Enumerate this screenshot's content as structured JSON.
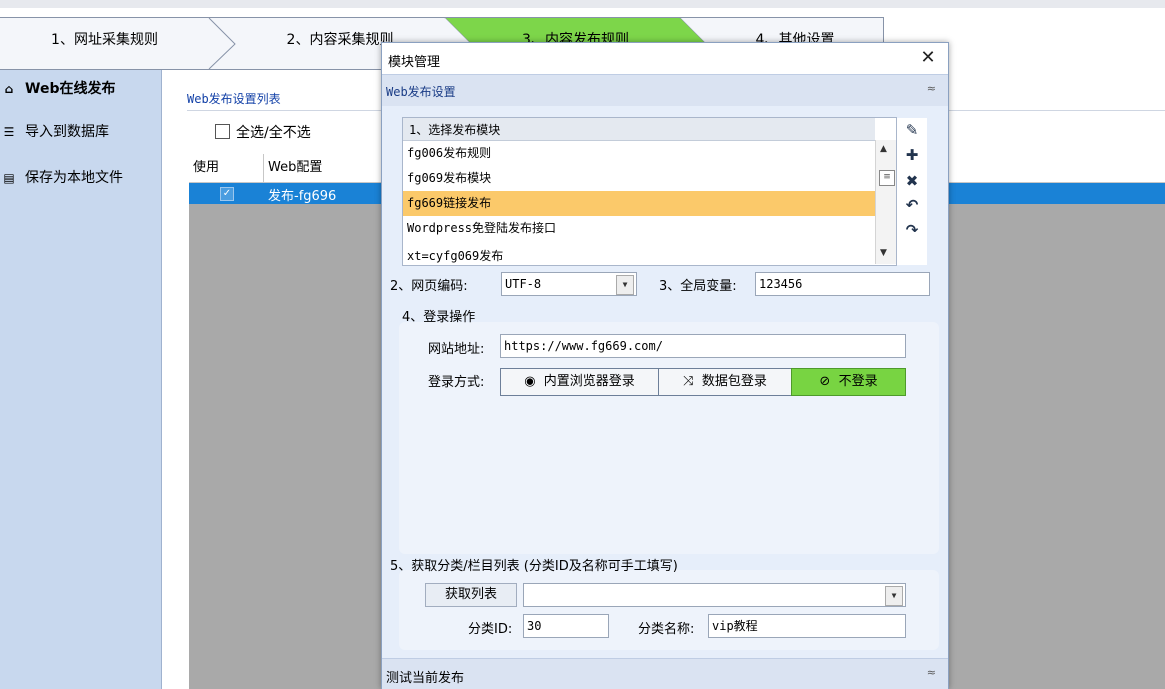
{
  "wizard": {
    "steps": [
      "1、网址采集规则",
      "2、内容采集规则",
      "3、内容发布规则",
      "4、其他设置"
    ],
    "active_color": "#7dd64a"
  },
  "left_nav": {
    "items": [
      {
        "label": "Web在线发布",
        "icon": "home-icon"
      },
      {
        "label": "导入到数据库",
        "icon": "database-icon"
      },
      {
        "label": "保存为本地文件",
        "icon": "file-icon"
      }
    ]
  },
  "publish_list": {
    "title": "Web发布设置列表",
    "select_all_label": "全选/全不选",
    "columns": [
      "使用",
      "Web配置"
    ],
    "rows": [
      {
        "checked": "✓",
        "config": "发布-fg696"
      }
    ]
  },
  "modal": {
    "title": "模块管理",
    "close_glyph": "✕",
    "section_title": "Web发布设置",
    "collapse_glyph": "≈",
    "module_list": {
      "header": "1、选择发布模块",
      "items": [
        "fg006发布规则",
        "fg069发布模块",
        "fg669链接发布",
        "Wordpress免登陆发布接口",
        "xt=cyfg069发布"
      ],
      "selected_index": 2
    },
    "encoding_label": "2、网页编码:",
    "encoding_value": "UTF-8",
    "global_var_label": "3、全局变量:",
    "global_var_value": "123456",
    "login_section_label": "4、登录操作",
    "site_url_label": "网站地址:",
    "site_url_value": "https://www.fg669.com/",
    "login_mode_label": "登录方式:",
    "login_buttons": [
      "内置浏览器登录",
      "数据包登录",
      "不登录"
    ],
    "login_active_index": 2,
    "category_section_label": "5、获取分类/栏目列表 (分类ID及名称可手工填写)",
    "get_list_button": "获取列表",
    "category_dropdown_value": "",
    "category_id_label": "分类ID:",
    "category_id_value": "30",
    "category_name_label": "分类名称:",
    "category_name_value": "vip教程",
    "test_section_title": "测试当前发布",
    "expand_glyph": "≈"
  }
}
